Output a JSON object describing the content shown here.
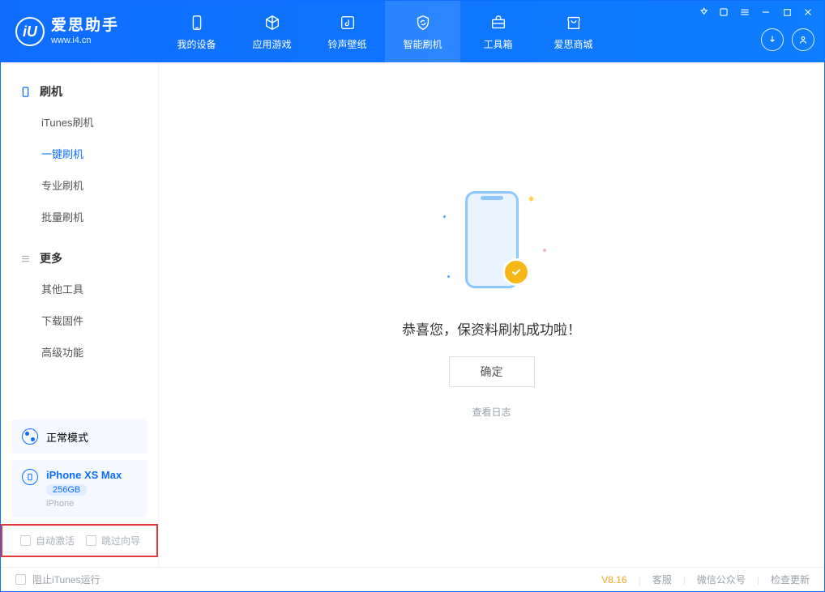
{
  "app": {
    "name": "爱思助手",
    "url": "www.i4.cn",
    "logo_letter": "iU"
  },
  "tabs": [
    {
      "label": "我的设备",
      "icon": "device"
    },
    {
      "label": "应用游戏",
      "icon": "cube"
    },
    {
      "label": "铃声壁纸",
      "icon": "music"
    },
    {
      "label": "智能刷机",
      "icon": "refresh",
      "active": true
    },
    {
      "label": "工具箱",
      "icon": "toolbox"
    },
    {
      "label": "爱思商城",
      "icon": "shop"
    }
  ],
  "sidebar": {
    "section1": {
      "title": "刷机"
    },
    "items1": [
      {
        "label": "iTunes刷机"
      },
      {
        "label": "一键刷机",
        "active": true
      },
      {
        "label": "专业刷机"
      },
      {
        "label": "批量刷机"
      }
    ],
    "section2": {
      "title": "更多"
    },
    "items2": [
      {
        "label": "其他工具"
      },
      {
        "label": "下载固件"
      },
      {
        "label": "高级功能"
      }
    ]
  },
  "status": {
    "mode_label": "正常模式"
  },
  "device": {
    "name": "iPhone XS Max",
    "storage": "256GB",
    "type": "iPhone"
  },
  "checkboxes": {
    "auto_activate": "自动激活",
    "skip_guide": "跳过向导"
  },
  "main": {
    "success_message": "恭喜您，保资料刷机成功啦！",
    "confirm_label": "确定",
    "view_log_label": "查看日志"
  },
  "footer": {
    "block_itunes": "阻止iTunes运行",
    "version": "V8.16",
    "customer_service": "客服",
    "wechat": "微信公众号",
    "check_update": "检查更新"
  }
}
